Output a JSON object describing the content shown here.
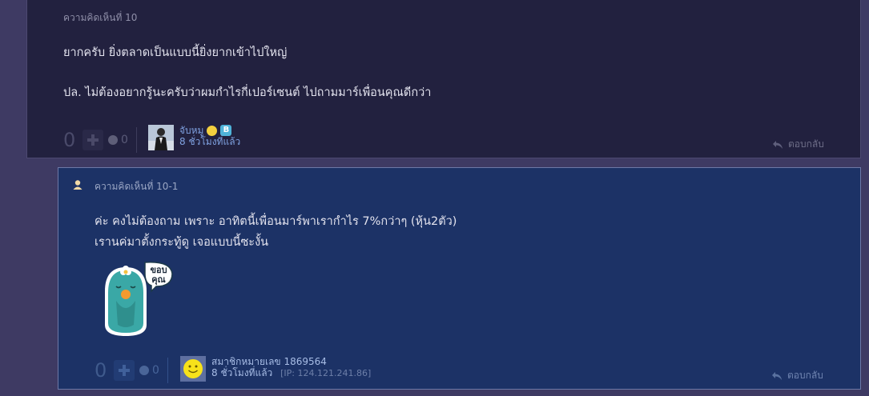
{
  "comment10": {
    "header": "ความคิดเห็นที่ 10",
    "line1": "ยากครับ ยิ่งตลาดเป็นแบบนี้ยิ่งยากเข้าไปใหญ่",
    "line2": "ปล. ไม่ต้องอยากรู้นะครับว่าผมกำไรกี่เปอร์เซนต์ ไปถามมาร์เพื่อนคุณดีกว่า",
    "vote_count": "0",
    "emotion_count": "0",
    "author_name": "จับหมู",
    "author_badge_letter": "B",
    "time": "8 ชั่วโมงที่แล้ว",
    "reply_label": "ตอบกลับ"
  },
  "comment10_1": {
    "header": "ความคิดเห็นที่ 10-1",
    "line1": "ค่ะ คงไม่ต้องถาม เพราะ อาทิตนี้เพื่อนมาร์พาเรากำไร 7%กว่าๆ (หุ้น2ตัว)",
    "line2": "เรานค่มาตั้งกระทู้ดู เจอแบบนี้ซะงั้น",
    "sticker_text_top": "ขอบ",
    "sticker_text_bottom": "คุณ",
    "vote_count": "0",
    "emotion_count": "0",
    "author_name": "สมาชิกหมายเลข 1869564",
    "time": "8 ชั่วโมงที่แล้ว",
    "ip": "[IP: 124.121.241.86]",
    "reply_label": "ตอบกลับ"
  },
  "icons": {
    "plus": "plus-icon",
    "emotion": "emotion-icon",
    "reply": "reply-arrow-icon",
    "user": "user-icon"
  },
  "colors": {
    "page_bg": "#3e3a63",
    "comment_bg": "#22213f",
    "reply_bg": "#1c3266",
    "link": "#7fa1e0"
  }
}
